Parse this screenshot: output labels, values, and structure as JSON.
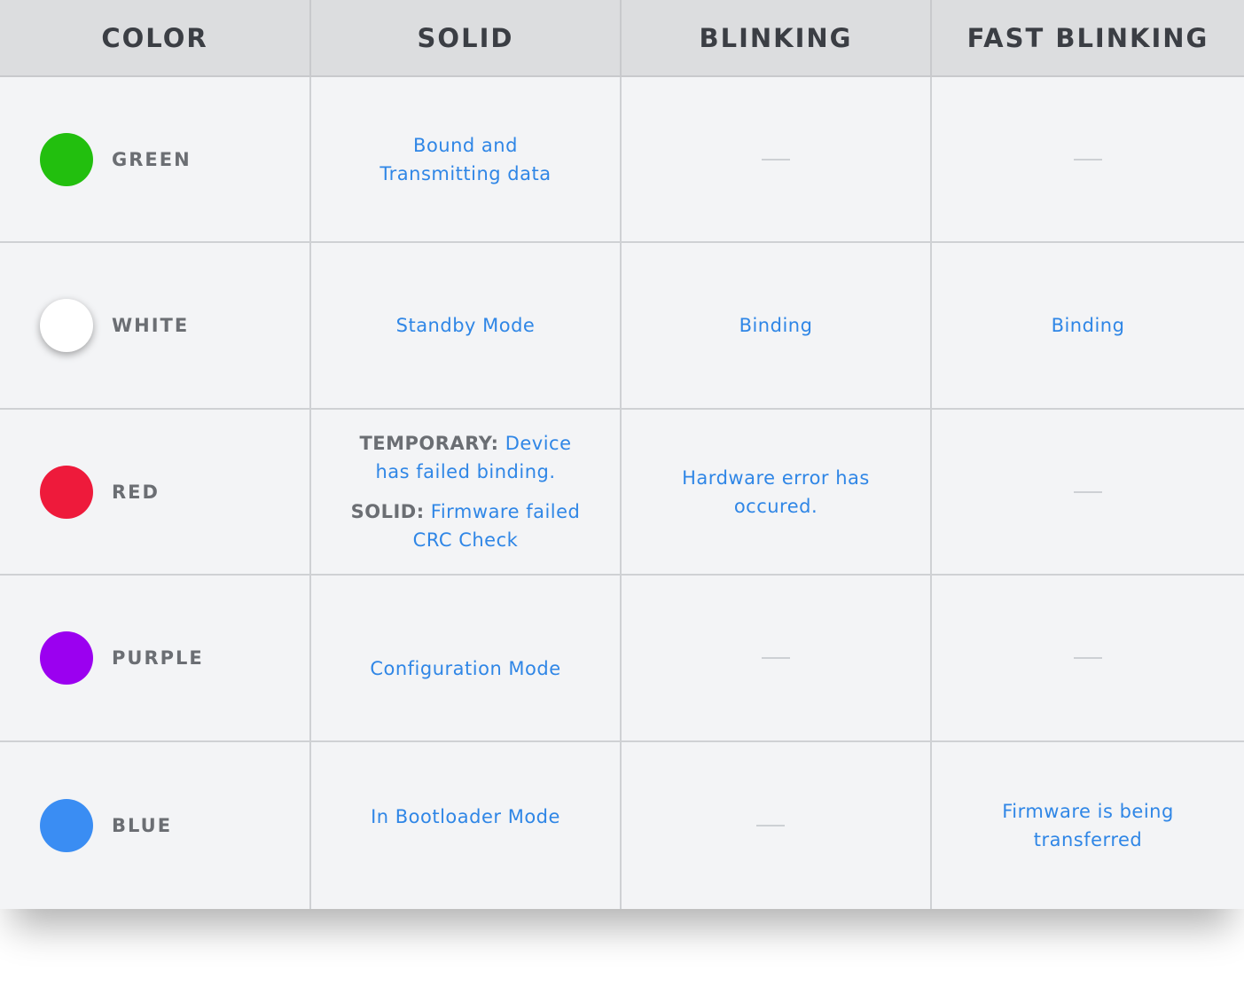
{
  "headers": [
    "COLOR",
    "SOLID",
    "BLINKING",
    "FAST BLINKING"
  ],
  "dash": "—",
  "rows": [
    {
      "color_name": "GREEN",
      "dot_color": "#22bf0e",
      "solid": [
        "Bound and",
        "Transmitting data"
      ],
      "blinking": "—",
      "fast_blinking": "—"
    },
    {
      "color_name": "WHITE",
      "dot_color": "#ffffff",
      "solid": "Standby Mode",
      "blinking": "Binding",
      "fast_blinking": "Binding"
    },
    {
      "color_name": "RED",
      "dot_color": "#ee1a3b",
      "solid_parts": [
        {
          "tag": "TEMPORARY",
          "sep": ":",
          "text_line1": " Device",
          "text_line2": "has failed binding."
        },
        {
          "tag": "SOLID",
          "sep": ":",
          "text_line1": " Firmware failed",
          "text_line2": "CRC Check"
        }
      ],
      "blinking": [
        "Hardware error has",
        "occured."
      ],
      "fast_blinking": "—"
    },
    {
      "color_name": "PURPLE",
      "dot_color": "#9b00f0",
      "solid": "Configuration Mode",
      "blinking": "—",
      "fast_blinking": "—"
    },
    {
      "color_name": "BLUE",
      "dot_color": "#3a8df3",
      "solid": "In Bootloader Mode",
      "blinking": "—",
      "fast_blinking": [
        "Firmware is being",
        "transferred"
      ]
    }
  ],
  "colors": {
    "header_bg": "#dcdddf",
    "body_bg": "#f3f4f6",
    "text_blue": "#2f86e6",
    "text_gray": "#6b6e73",
    "header_text": "#3b3e44"
  }
}
